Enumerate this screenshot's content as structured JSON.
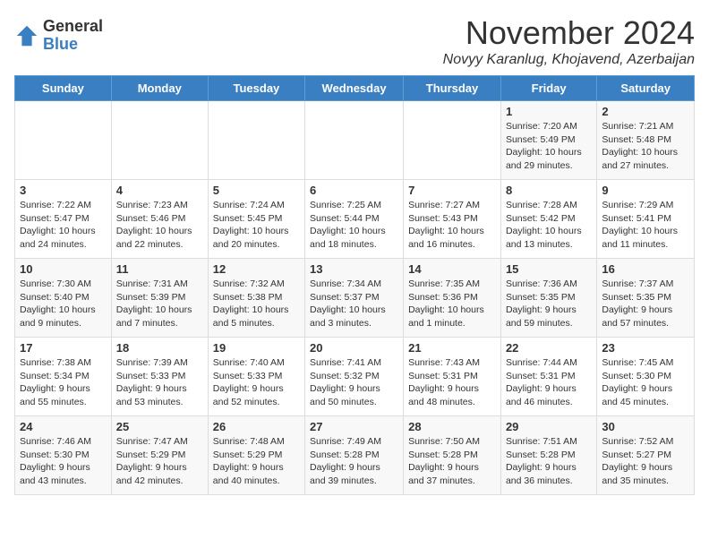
{
  "logo": {
    "general": "General",
    "blue": "Blue"
  },
  "header": {
    "month": "November 2024",
    "location": "Novyy Karanlug, Khojavend, Azerbaijan"
  },
  "weekdays": [
    "Sunday",
    "Monday",
    "Tuesday",
    "Wednesday",
    "Thursday",
    "Friday",
    "Saturday"
  ],
  "weeks": [
    [
      {
        "day": "",
        "info": ""
      },
      {
        "day": "",
        "info": ""
      },
      {
        "day": "",
        "info": ""
      },
      {
        "day": "",
        "info": ""
      },
      {
        "day": "",
        "info": ""
      },
      {
        "day": "1",
        "info": "Sunrise: 7:20 AM\nSunset: 5:49 PM\nDaylight: 10 hours and 29 minutes."
      },
      {
        "day": "2",
        "info": "Sunrise: 7:21 AM\nSunset: 5:48 PM\nDaylight: 10 hours and 27 minutes."
      }
    ],
    [
      {
        "day": "3",
        "info": "Sunrise: 7:22 AM\nSunset: 5:47 PM\nDaylight: 10 hours and 24 minutes."
      },
      {
        "day": "4",
        "info": "Sunrise: 7:23 AM\nSunset: 5:46 PM\nDaylight: 10 hours and 22 minutes."
      },
      {
        "day": "5",
        "info": "Sunrise: 7:24 AM\nSunset: 5:45 PM\nDaylight: 10 hours and 20 minutes."
      },
      {
        "day": "6",
        "info": "Sunrise: 7:25 AM\nSunset: 5:44 PM\nDaylight: 10 hours and 18 minutes."
      },
      {
        "day": "7",
        "info": "Sunrise: 7:27 AM\nSunset: 5:43 PM\nDaylight: 10 hours and 16 minutes."
      },
      {
        "day": "8",
        "info": "Sunrise: 7:28 AM\nSunset: 5:42 PM\nDaylight: 10 hours and 13 minutes."
      },
      {
        "day": "9",
        "info": "Sunrise: 7:29 AM\nSunset: 5:41 PM\nDaylight: 10 hours and 11 minutes."
      }
    ],
    [
      {
        "day": "10",
        "info": "Sunrise: 7:30 AM\nSunset: 5:40 PM\nDaylight: 10 hours and 9 minutes."
      },
      {
        "day": "11",
        "info": "Sunrise: 7:31 AM\nSunset: 5:39 PM\nDaylight: 10 hours and 7 minutes."
      },
      {
        "day": "12",
        "info": "Sunrise: 7:32 AM\nSunset: 5:38 PM\nDaylight: 10 hours and 5 minutes."
      },
      {
        "day": "13",
        "info": "Sunrise: 7:34 AM\nSunset: 5:37 PM\nDaylight: 10 hours and 3 minutes."
      },
      {
        "day": "14",
        "info": "Sunrise: 7:35 AM\nSunset: 5:36 PM\nDaylight: 10 hours and 1 minute."
      },
      {
        "day": "15",
        "info": "Sunrise: 7:36 AM\nSunset: 5:35 PM\nDaylight: 9 hours and 59 minutes."
      },
      {
        "day": "16",
        "info": "Sunrise: 7:37 AM\nSunset: 5:35 PM\nDaylight: 9 hours and 57 minutes."
      }
    ],
    [
      {
        "day": "17",
        "info": "Sunrise: 7:38 AM\nSunset: 5:34 PM\nDaylight: 9 hours and 55 minutes."
      },
      {
        "day": "18",
        "info": "Sunrise: 7:39 AM\nSunset: 5:33 PM\nDaylight: 9 hours and 53 minutes."
      },
      {
        "day": "19",
        "info": "Sunrise: 7:40 AM\nSunset: 5:33 PM\nDaylight: 9 hours and 52 minutes."
      },
      {
        "day": "20",
        "info": "Sunrise: 7:41 AM\nSunset: 5:32 PM\nDaylight: 9 hours and 50 minutes."
      },
      {
        "day": "21",
        "info": "Sunrise: 7:43 AM\nSunset: 5:31 PM\nDaylight: 9 hours and 48 minutes."
      },
      {
        "day": "22",
        "info": "Sunrise: 7:44 AM\nSunset: 5:31 PM\nDaylight: 9 hours and 46 minutes."
      },
      {
        "day": "23",
        "info": "Sunrise: 7:45 AM\nSunset: 5:30 PM\nDaylight: 9 hours and 45 minutes."
      }
    ],
    [
      {
        "day": "24",
        "info": "Sunrise: 7:46 AM\nSunset: 5:30 PM\nDaylight: 9 hours and 43 minutes."
      },
      {
        "day": "25",
        "info": "Sunrise: 7:47 AM\nSunset: 5:29 PM\nDaylight: 9 hours and 42 minutes."
      },
      {
        "day": "26",
        "info": "Sunrise: 7:48 AM\nSunset: 5:29 PM\nDaylight: 9 hours and 40 minutes."
      },
      {
        "day": "27",
        "info": "Sunrise: 7:49 AM\nSunset: 5:28 PM\nDaylight: 9 hours and 39 minutes."
      },
      {
        "day": "28",
        "info": "Sunrise: 7:50 AM\nSunset: 5:28 PM\nDaylight: 9 hours and 37 minutes."
      },
      {
        "day": "29",
        "info": "Sunrise: 7:51 AM\nSunset: 5:28 PM\nDaylight: 9 hours and 36 minutes."
      },
      {
        "day": "30",
        "info": "Sunrise: 7:52 AM\nSunset: 5:27 PM\nDaylight: 9 hours and 35 minutes."
      }
    ]
  ]
}
